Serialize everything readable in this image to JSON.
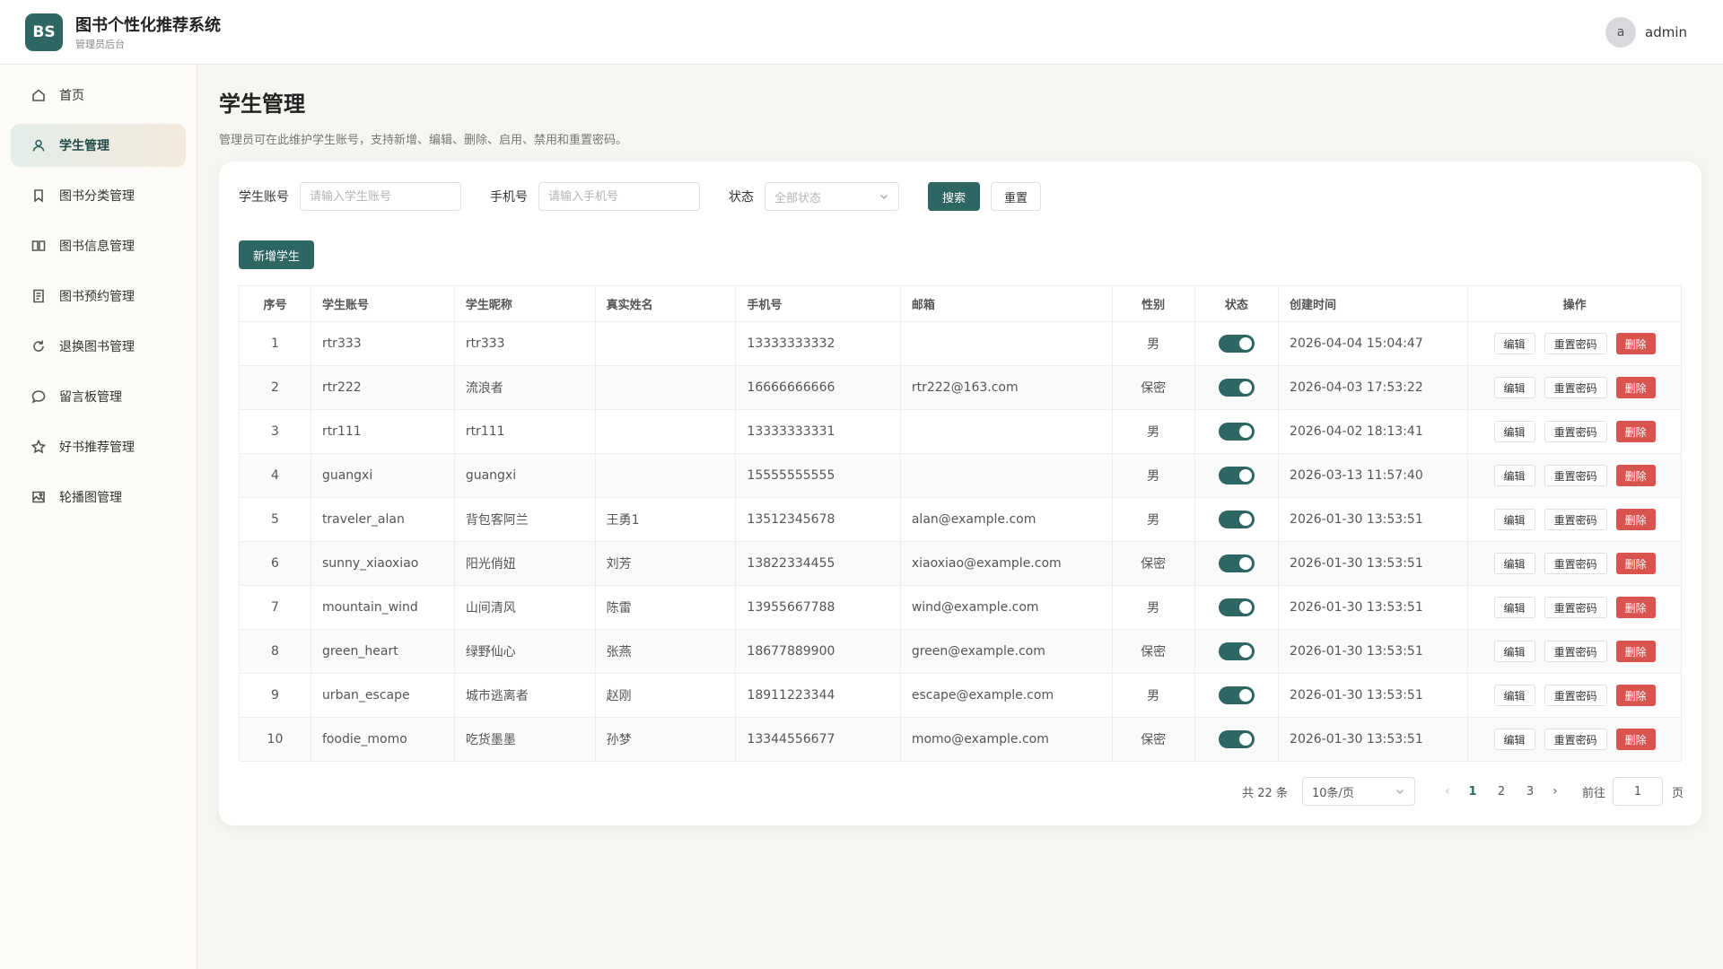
{
  "header": {
    "logo": "BS",
    "title": "图书个性化推荐系统",
    "subtitle": "管理员后台",
    "avatar_letter": "a",
    "username": "admin"
  },
  "sidebar": {
    "items": [
      {
        "label": "首页",
        "icon": "home-icon"
      },
      {
        "label": "学生管理",
        "icon": "user-icon",
        "active": true
      },
      {
        "label": "图书分类管理",
        "icon": "bookmark-icon"
      },
      {
        "label": "图书信息管理",
        "icon": "book-open-icon"
      },
      {
        "label": "图书预约管理",
        "icon": "document-icon"
      },
      {
        "label": "退换图书管理",
        "icon": "refresh-icon"
      },
      {
        "label": "留言板管理",
        "icon": "chat-icon"
      },
      {
        "label": "好书推荐管理",
        "icon": "star-icon"
      },
      {
        "label": "轮播图管理",
        "icon": "image-icon"
      }
    ]
  },
  "page": {
    "title": "学生管理",
    "description": "管理员可在此维护学生账号，支持新增、编辑、删除、启用、禁用和重置密码。"
  },
  "filters": {
    "account_label": "学生账号",
    "account_placeholder": "请输入学生账号",
    "phone_label": "手机号",
    "phone_placeholder": "请输入手机号",
    "status_label": "状态",
    "status_value": "全部状态",
    "search_label": "搜索",
    "reset_label": "重置"
  },
  "add_button": "新增学生",
  "table": {
    "headers": [
      "序号",
      "学生账号",
      "学生昵称",
      "真实姓名",
      "手机号",
      "邮箱",
      "性别",
      "状态",
      "创建时间",
      "操作"
    ],
    "rows": [
      {
        "no": "1",
        "account": "rtr333",
        "nickname": "rtr333",
        "realname": "",
        "phone": "13333333332",
        "email": "",
        "gender": "男",
        "enabled": true,
        "created": "2026-04-04 15:04:47"
      },
      {
        "no": "2",
        "account": "rtr222",
        "nickname": "流浪者",
        "realname": "",
        "phone": "16666666666",
        "email": "rtr222@163.com",
        "gender": "保密",
        "enabled": true,
        "created": "2026-04-03 17:53:22"
      },
      {
        "no": "3",
        "account": "rtr111",
        "nickname": "rtr111",
        "realname": "",
        "phone": "13333333331",
        "email": "",
        "gender": "男",
        "enabled": true,
        "created": "2026-04-02 18:13:41"
      },
      {
        "no": "4",
        "account": "guangxi",
        "nickname": "guangxi",
        "realname": "",
        "phone": "15555555555",
        "email": "",
        "gender": "男",
        "enabled": true,
        "created": "2026-03-13 11:57:40"
      },
      {
        "no": "5",
        "account": "traveler_alan",
        "nickname": "背包客阿兰",
        "realname": "王勇1",
        "phone": "13512345678",
        "email": "alan@example.com",
        "gender": "男",
        "enabled": true,
        "created": "2026-01-30 13:53:51"
      },
      {
        "no": "6",
        "account": "sunny_xiaoxiao",
        "nickname": "阳光俏妞",
        "realname": "刘芳",
        "phone": "13822334455",
        "email": "xiaoxiao@example.com",
        "gender": "保密",
        "enabled": true,
        "created": "2026-01-30 13:53:51"
      },
      {
        "no": "7",
        "account": "mountain_wind",
        "nickname": "山间清风",
        "realname": "陈雷",
        "phone": "13955667788",
        "email": "wind@example.com",
        "gender": "男",
        "enabled": true,
        "created": "2026-01-30 13:53:51"
      },
      {
        "no": "8",
        "account": "green_heart",
        "nickname": "绿野仙心",
        "realname": "张燕",
        "phone": "18677889900",
        "email": "green@example.com",
        "gender": "保密",
        "enabled": true,
        "created": "2026-01-30 13:53:51"
      },
      {
        "no": "9",
        "account": "urban_escape",
        "nickname": "城市逃离者",
        "realname": "赵刚",
        "phone": "18911223344",
        "email": "escape@example.com",
        "gender": "男",
        "enabled": true,
        "created": "2026-01-30 13:53:51"
      },
      {
        "no": "10",
        "account": "foodie_momo",
        "nickname": "吃货墨墨",
        "realname": "孙梦",
        "phone": "13344556677",
        "email": "momo@example.com",
        "gender": "保密",
        "enabled": true,
        "created": "2026-01-30 13:53:51"
      }
    ],
    "ops": {
      "edit": "编辑",
      "reset_pwd": "重置密码",
      "delete": "删除"
    }
  },
  "pagination": {
    "total": "共 22 条",
    "page_size": "10条/页",
    "pages": [
      "1",
      "2",
      "3"
    ],
    "current": "1",
    "goto_label": "前往",
    "goto_value": "1",
    "page_unit": "页"
  },
  "colors": {
    "primary": "#2e6663",
    "danger": "#d9534f"
  }
}
